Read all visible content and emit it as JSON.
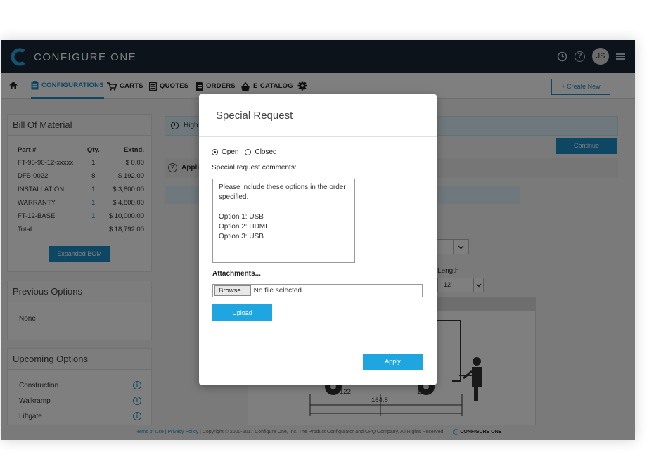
{
  "app": {
    "name": "CONFIGURE ONE",
    "avatar_initials": "JS"
  },
  "nav": {
    "items": [
      {
        "label": "CONFIGURATIONS",
        "icon": "clipboard-icon"
      },
      {
        "label": "CARTS",
        "icon": "cart-icon"
      },
      {
        "label": "QUOTES",
        "icon": "list-icon"
      },
      {
        "label": "ORDERS",
        "icon": "document-icon"
      },
      {
        "label": "E-CATALOG",
        "icon": "basket-icon"
      }
    ],
    "create_new": "+ Create New"
  },
  "bom": {
    "title": "Bill Of Material",
    "headers": [
      "Part #",
      "Qty.",
      "Extnd."
    ],
    "rows": [
      {
        "part": "FT-96-90-12-xxxxx",
        "qty": "1",
        "ext": "$ 0.00"
      },
      {
        "part": "DFB-0022",
        "qty": "8",
        "ext": "$ 192.00"
      },
      {
        "part": "INSTALLATION",
        "qty": "1",
        "ext": "$ 3,800.00"
      },
      {
        "part": "WARRANTY",
        "qty": "1",
        "ext": "$ 4,800.00"
      },
      {
        "part": "FT-12-BASE",
        "qty": "1",
        "ext": "$ 10,000.00"
      }
    ],
    "total_label": "Total",
    "total_value": "$ 18,792.00",
    "expand_button": "Expanded BOM"
  },
  "previous_options": {
    "title": "Previous Options",
    "value": "None"
  },
  "upcoming_options": {
    "title": "Upcoming Options",
    "items": [
      "Construction",
      "Walkramp",
      "Liftgate"
    ]
  },
  "main": {
    "alert_text": "High",
    "continue_button": "Continue",
    "apply_text": "Appli",
    "length_label": "Length",
    "length_value": "12'",
    "dims": [
      "122",
      "164.8",
      "144"
    ]
  },
  "footer": {
    "terms": "Terms of Use",
    "privacy": "Privacy Policy",
    "copyright": "Copyright © 2000-2017 Configure One, Inc. The Product Configurator and CPQ Company. All Rights Reserved.",
    "logo_text": "CONFIGURE ONE"
  },
  "modal": {
    "title": "Special Request",
    "radio_open": "Open",
    "radio_closed": "Closed",
    "comments_label": "Special request comments:",
    "comments_value": "Please include these options in the order specified.\n\nOption 1: USB\nOption 2: HDMI\nOption 3: USB",
    "attachments_label": "Attachments...",
    "browse_button": "Browse...",
    "file_status": "No file selected.",
    "upload_button": "Upload",
    "apply_button": "Apply"
  },
  "colors": {
    "topbar": "#1b2737",
    "accent": "#1a8ec9",
    "button": "#1fa5e0"
  }
}
